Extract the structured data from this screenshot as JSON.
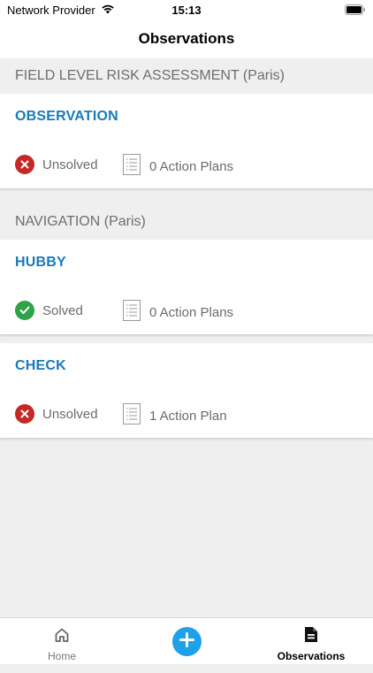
{
  "status_bar": {
    "carrier": "Network Provider",
    "time": "15:13"
  },
  "nav": {
    "title": "Observations"
  },
  "sections": [
    {
      "header": "FIELD LEVEL RISK ASSESSMENT (Paris)",
      "cards": [
        {
          "title": "OBSERVATION",
          "status": "Unsolved",
          "plans": "0 Action Plans"
        }
      ]
    },
    {
      "header": "NAVIGATION (Paris)",
      "cards": [
        {
          "title": "HUBBY",
          "status": "Solved",
          "plans": "0 Action Plans"
        },
        {
          "title": "CHECK",
          "status": "Unsolved",
          "plans": "1 Action Plan"
        }
      ]
    }
  ],
  "tab_bar": {
    "home_label": "Home",
    "observations_label": "Observations"
  },
  "colors": {
    "accent": "#1a7ab8",
    "solved": "#2fa24a",
    "unsolved": "#c62828",
    "add_button": "#1da1e8"
  }
}
